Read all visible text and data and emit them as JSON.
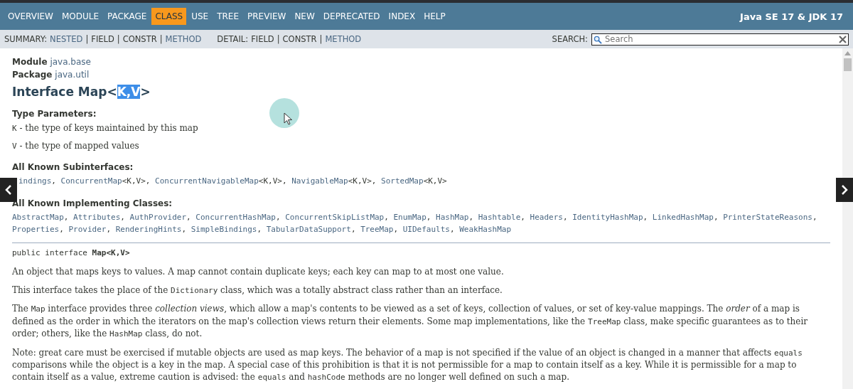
{
  "top_nav": {
    "items": [
      {
        "label": "OVERVIEW",
        "selected": false
      },
      {
        "label": "MODULE",
        "selected": false
      },
      {
        "label": "PACKAGE",
        "selected": false
      },
      {
        "label": "CLASS",
        "selected": true
      },
      {
        "label": "USE",
        "selected": false
      },
      {
        "label": "TREE",
        "selected": false
      },
      {
        "label": "PREVIEW",
        "selected": false
      },
      {
        "label": "NEW",
        "selected": false
      },
      {
        "label": "DEPRECATED",
        "selected": false
      },
      {
        "label": "INDEX",
        "selected": false
      },
      {
        "label": "HELP",
        "selected": false
      }
    ],
    "about": "Java SE 17 & JDK 17"
  },
  "sub_nav": {
    "groups": [
      {
        "label": "SUMMARY:",
        "items": [
          {
            "label": "NESTED",
            "link": true
          },
          {
            "label": "FIELD",
            "link": false
          },
          {
            "label": "CONSTR",
            "link": false
          },
          {
            "label": "METHOD",
            "link": true
          }
        ]
      },
      {
        "label": "DETAIL:",
        "items": [
          {
            "label": "FIELD",
            "link": false
          },
          {
            "label": "CONSTR",
            "link": false
          },
          {
            "label": "METHOD",
            "link": true
          }
        ]
      }
    ],
    "separator": "|",
    "search_label": "SEARCH:",
    "search": {
      "placeholder": "Search"
    }
  },
  "header": {
    "module_label": "Module",
    "module": "java.base",
    "package_label": "Package",
    "package": "java.util",
    "title": {
      "before": "Interface Map<",
      "highlighted": "K,V",
      "after": ">"
    }
  },
  "type_parameters": {
    "heading": "Type Parameters:",
    "params": [
      {
        "name": "K",
        "description": " - the type of keys maintained by this map"
      },
      {
        "name": "V",
        "description": " - the type of mapped values"
      }
    ]
  },
  "subinterfaces": {
    "heading": "All Known Subinterfaces:",
    "separator": ",",
    "items": [
      {
        "name": "indings"
      },
      {
        "name": "ConcurrentMap",
        "generic": "<K,V>"
      },
      {
        "name": "ConcurrentNavigableMap",
        "generic": "<K,V>"
      },
      {
        "name": "NavigableMap",
        "generic": "<K,V>"
      },
      {
        "name": "SortedMap",
        "generic": "<K,V>"
      }
    ]
  },
  "implementing_classes": {
    "heading": "All Known Implementing Classes:",
    "separator": ",",
    "items": [
      "AbstractMap",
      "Attributes",
      "AuthProvider",
      "ConcurrentHashMap",
      "ConcurrentSkipListMap",
      "EnumMap",
      "HashMap",
      "Hashtable",
      "Headers",
      "IdentityHashMap",
      "LinkedHashMap",
      "PrinterStateReasons",
      "Properties",
      "Provider",
      "RenderingHints",
      "SimpleBindings",
      "TabularDataSupport",
      "TreeMap",
      "UIDefaults",
      "WeakHashMap"
    ]
  },
  "signature": {
    "modifiers": "public interface ",
    "name": "Map<K,V>"
  },
  "paragraphs": [
    [
      {
        "kind": "text",
        "text": "An object that maps keys to values. A map cannot contain duplicate keys; each key can map to at most one value."
      }
    ],
    [
      {
        "kind": "text",
        "text": "This interface takes the place of the "
      },
      {
        "kind": "code",
        "text": "Dictionary"
      },
      {
        "kind": "text",
        "text": " class, which was a totally abstract class rather than an interface."
      }
    ],
    [
      {
        "kind": "text",
        "text": "The "
      },
      {
        "kind": "code",
        "text": "Map"
      },
      {
        "kind": "text",
        "text": " interface provides three "
      },
      {
        "kind": "em",
        "text": "collection views"
      },
      {
        "kind": "text",
        "text": ", which allow a map's contents to be viewed as a set of keys, collection of values, or set of key-value mappings. The "
      },
      {
        "kind": "em",
        "text": "order"
      },
      {
        "kind": "text",
        "text": " of a map is defined as the order in which the iterators on the map's collection views return their elements. Some map implementations, like the "
      },
      {
        "kind": "code",
        "text": "TreeMap"
      },
      {
        "kind": "text",
        "text": " class, make specific guarantees as to their order; others, like the "
      },
      {
        "kind": "code",
        "text": "HashMap"
      },
      {
        "kind": "text",
        "text": " class, do not."
      }
    ],
    [
      {
        "kind": "text",
        "text": "Note: great care must be exercised if mutable objects are used as map keys. The behavior of a map is not specified if the value of an object is changed in a manner that affects "
      },
      {
        "kind": "code",
        "text": "equals"
      },
      {
        "kind": "text",
        "text": " comparisons while the object is a key in the map. A special case of this prohibition is that it is not permissible for a map to contain itself as a key. While it is permissible for a map to contain itself as a value, extreme caution is advised: the "
      },
      {
        "kind": "code",
        "text": "equals"
      },
      {
        "kind": "text",
        "text": " and "
      },
      {
        "kind": "code",
        "text": "hashCode"
      },
      {
        "kind": "text",
        "text": " methods are no longer well defined on such a map."
      }
    ]
  ]
}
